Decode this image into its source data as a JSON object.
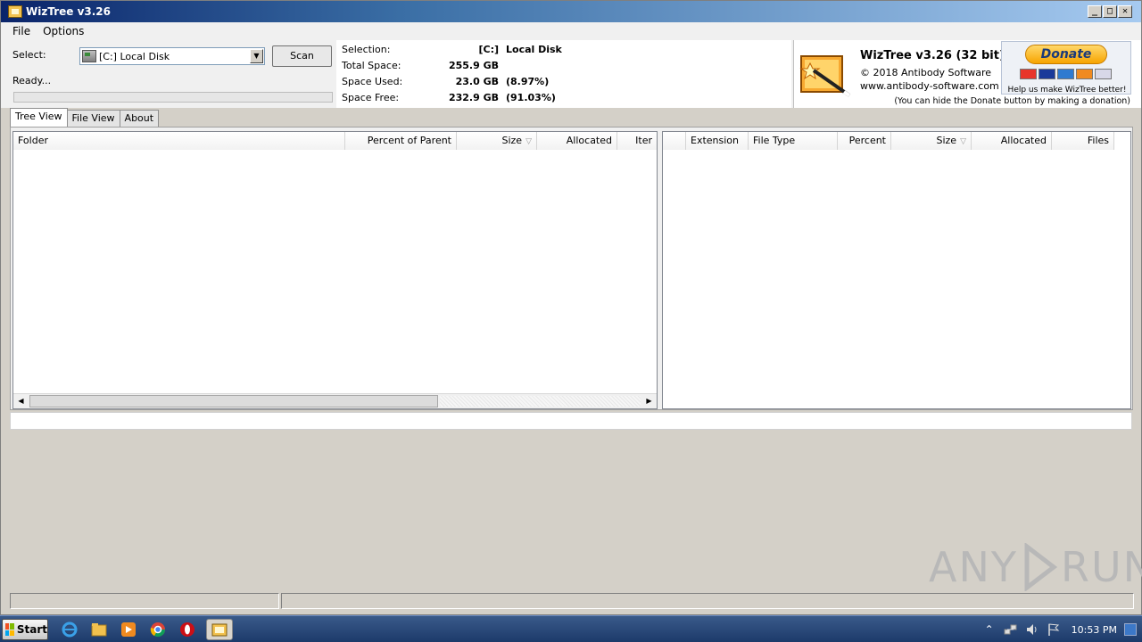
{
  "window": {
    "title": "WizTree v3.26"
  },
  "menu": {
    "file": "File",
    "options": "Options"
  },
  "controls": {
    "select_label": "Select:",
    "drive_value": "[C:] Local Disk",
    "scan_label": "Scan",
    "status_text": "Ready..."
  },
  "selection": {
    "selection_label": "Selection:",
    "selection_value": "[C:]",
    "selection_extra": "Local Disk",
    "total_label": "Total Space:",
    "total_value": "255.9 GB",
    "used_label": "Space Used:",
    "used_value": "23.0 GB",
    "used_pct": "(8.97%)",
    "free_label": "Space Free:",
    "free_value": "232.9 GB",
    "free_pct": "(91.03%)"
  },
  "about": {
    "app_name": "WizTree v3.26 (32 bit)",
    "copyright": "© 2018 Antibody Software",
    "website": "www.antibody-software.com",
    "donate_label": "Donate",
    "donate_help": "Help us make WizTree better!",
    "hide_note": "(You can hide the Donate button by making a donation)"
  },
  "tabs": [
    {
      "label": "Tree View",
      "active": true
    },
    {
      "label": "File View",
      "active": false
    },
    {
      "label": "About",
      "active": false
    }
  ],
  "tree_columns": [
    "Folder",
    "Percent of Parent",
    "Size",
    "Allocated",
    "Iter"
  ],
  "ext_columns": [
    "",
    "Extension",
    "File Type",
    "Percent",
    "Size",
    "Allocated",
    "Files"
  ],
  "taskbar": {
    "start_label": "Start",
    "clock": "10:53 PM",
    "pinned": [
      "ie-icon",
      "explorer-icon",
      "media-player-icon",
      "chrome-icon",
      "opera-icon",
      "wiztree-icon"
    ]
  },
  "watermark": {
    "text_left": "ANY",
    "text_right": "RUN"
  },
  "colors": {
    "title_start": "#0a246a",
    "title_end": "#a6caf0",
    "donate_gold": "#f7a400",
    "window_bg": "#d4d0c8"
  }
}
